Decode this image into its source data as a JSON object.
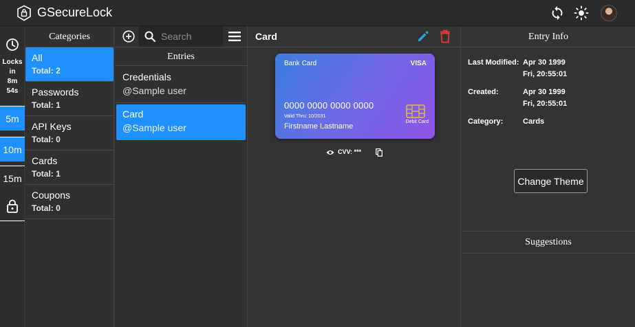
{
  "app": {
    "title": "GSecureLock"
  },
  "rail": {
    "lock_timer": [
      "Locks",
      "in",
      "8m",
      "54s"
    ],
    "durations": [
      "5m",
      "10m",
      "15m"
    ]
  },
  "categories": {
    "header": "Categories",
    "items": [
      {
        "name": "All",
        "total": "Total: 2"
      },
      {
        "name": "Passwords",
        "total": "Total: 1"
      },
      {
        "name": "API Keys",
        "total": "Total: 0"
      },
      {
        "name": "Cards",
        "total": "Total: 1"
      },
      {
        "name": "Coupons",
        "total": "Total: 0"
      }
    ]
  },
  "entries": {
    "search_placeholder": "Search",
    "header": "Entries",
    "items": [
      {
        "title": "Credentials",
        "subtitle": "@Sample user"
      },
      {
        "title": "Card",
        "subtitle": "@Sample user"
      }
    ]
  },
  "detail": {
    "title": "Card",
    "card": {
      "kind": "Bank Card",
      "brand": "VISA",
      "number": "0000 0000 0000 0000",
      "valid_thru": "Valid Thru: 10/2031",
      "holder": "Firstname Lastname",
      "type": "Debit Card"
    },
    "cvv": "CVV: ***"
  },
  "info": {
    "header": "Entry Info",
    "last_modified_label": "Last Modified:",
    "last_modified_date": "Apr 30 1999",
    "last_modified_time": "Fri, 20:55:01",
    "created_label": "Created:",
    "created_date": "Apr 30 1999",
    "created_time": "Fri, 20:55:01",
    "category_label": "Category:",
    "category_value": "Cards",
    "change_theme": "Change Theme",
    "suggestions": "Suggestions"
  },
  "colors": {
    "accent": "#1e90ff",
    "edit": "#2a9fd6",
    "delete": "#e53935",
    "chip": "#e8c13a"
  }
}
